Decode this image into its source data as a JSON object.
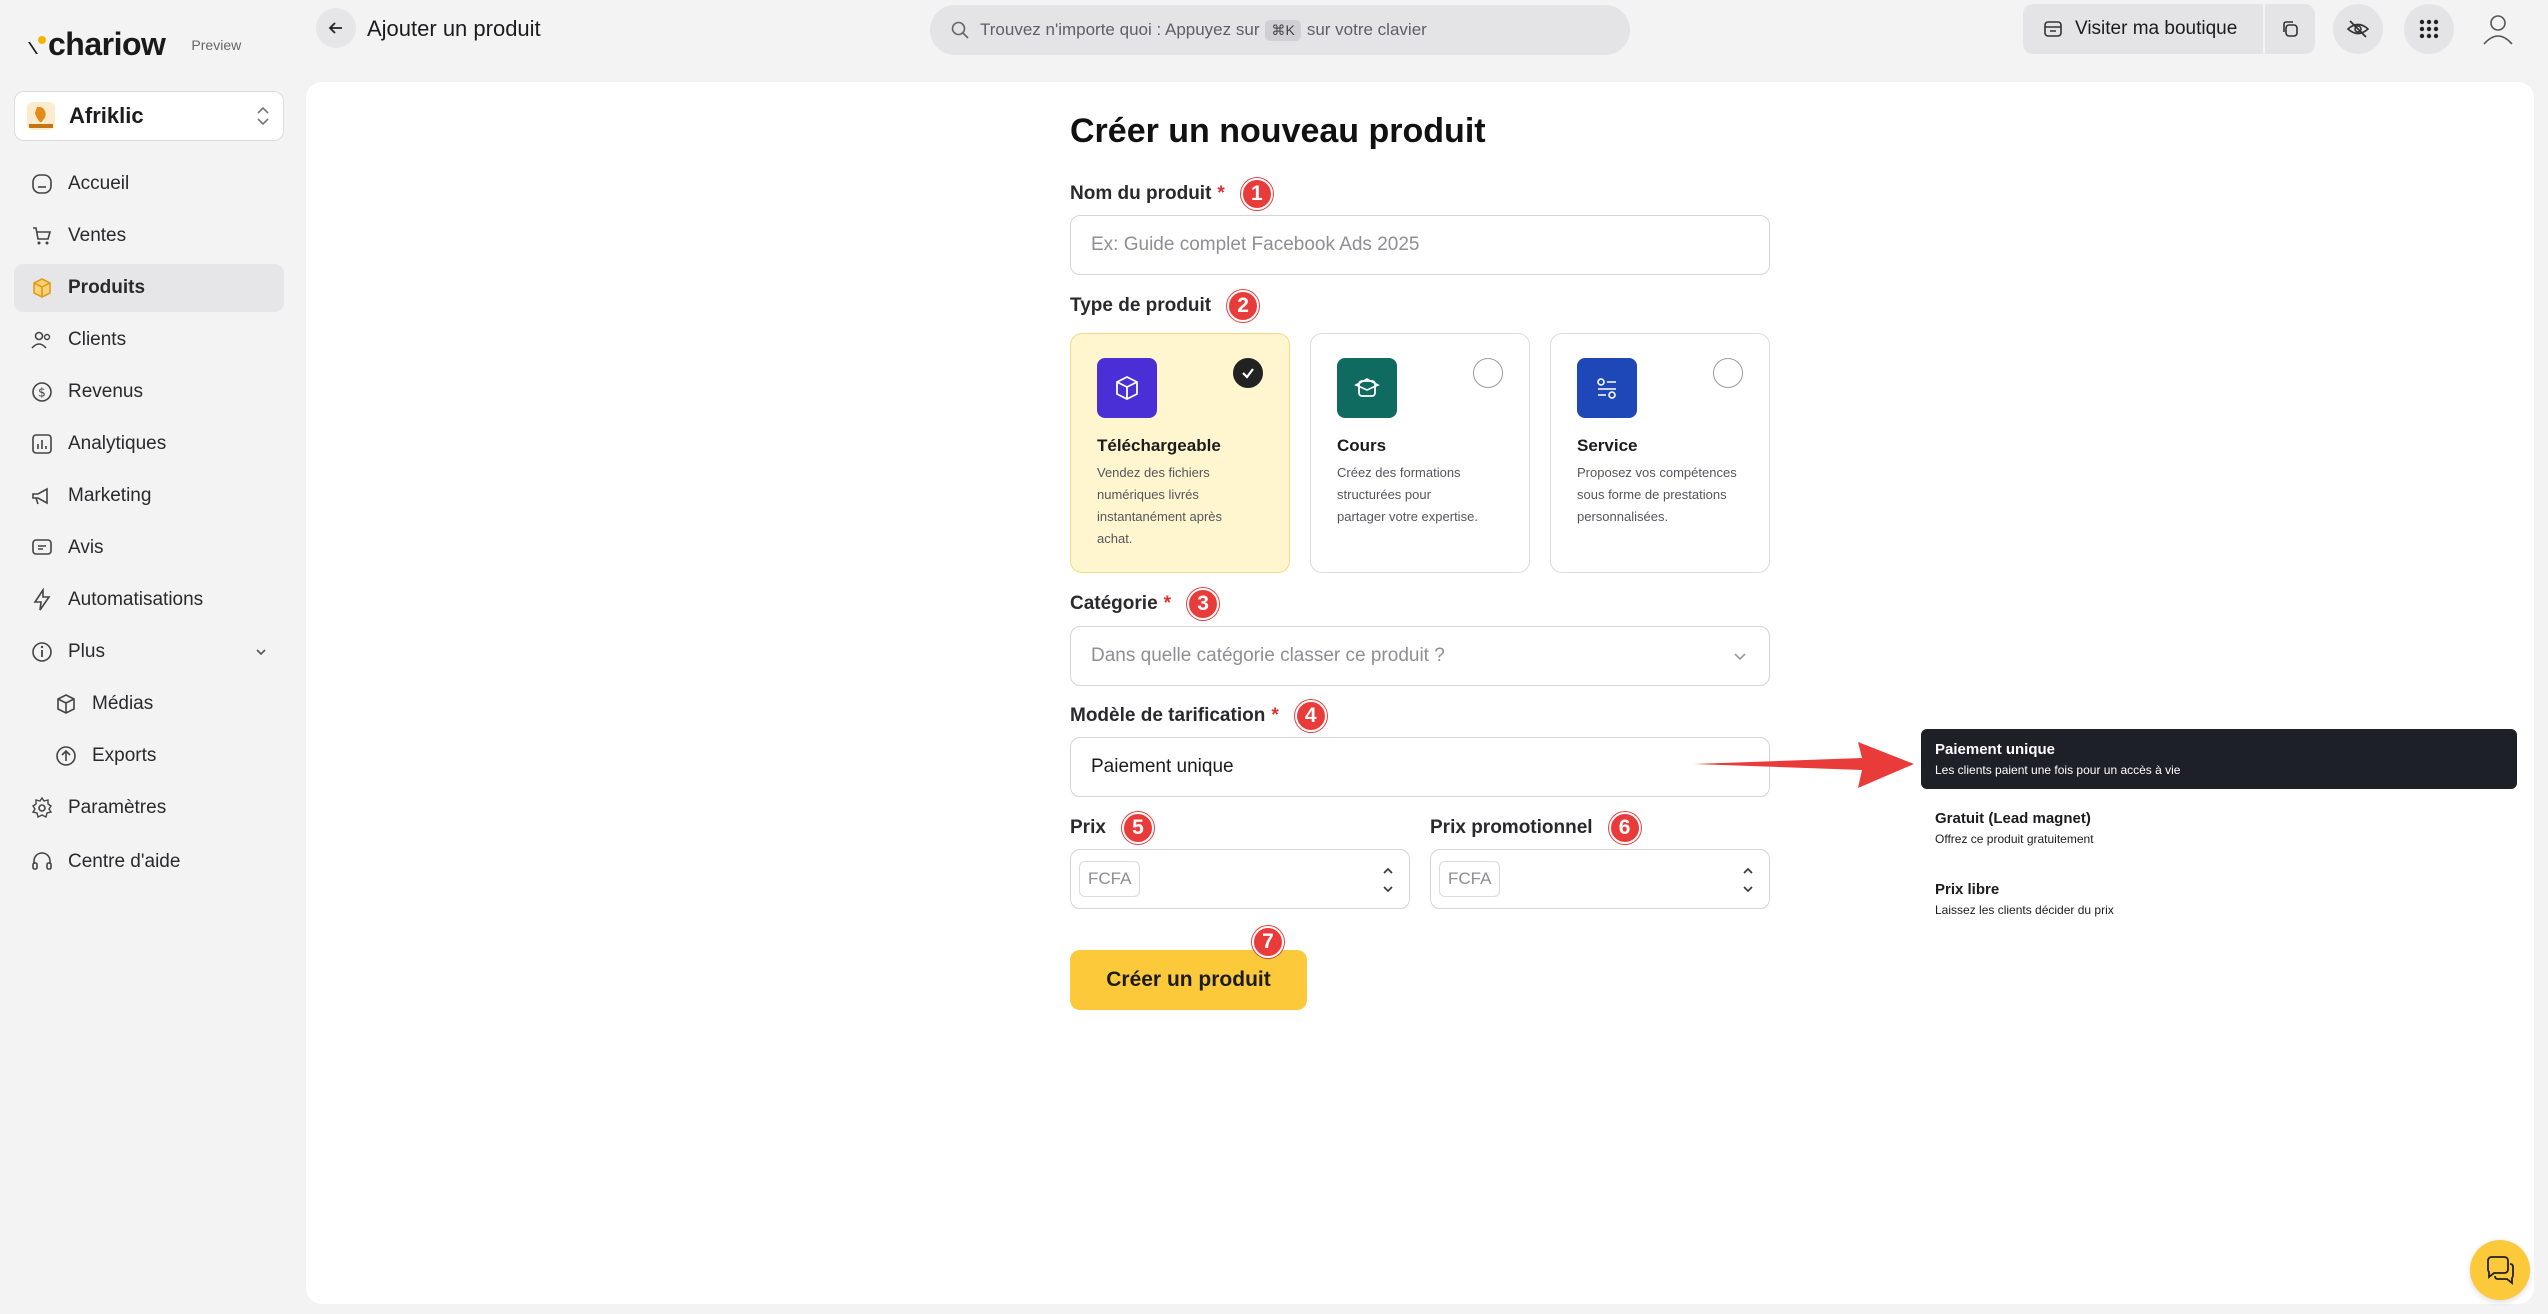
{
  "app": {
    "brand": "chariow",
    "badge": "Preview"
  },
  "shop": {
    "name": "Afriklic",
    "avatar_text": "AFRIKLIC"
  },
  "sidebar": {
    "items": [
      {
        "label": "Accueil",
        "icon": "home-icon"
      },
      {
        "label": "Ventes",
        "icon": "cart-icon"
      },
      {
        "label": "Produits",
        "icon": "box-icon",
        "active": true
      },
      {
        "label": "Clients",
        "icon": "users-icon"
      },
      {
        "label": "Revenus",
        "icon": "dollar-icon"
      },
      {
        "label": "Analytiques",
        "icon": "bar-chart-icon"
      },
      {
        "label": "Marketing",
        "icon": "megaphone-icon"
      },
      {
        "label": "Avis",
        "icon": "message-icon"
      },
      {
        "label": "Automatisations",
        "icon": "bolt-icon"
      },
      {
        "label": "Plus",
        "icon": "info-icon"
      },
      {
        "label": "Médias",
        "icon": "box-icon"
      },
      {
        "label": "Exports",
        "icon": "upload-icon"
      },
      {
        "label": "Paramètres",
        "icon": "gear-icon"
      }
    ],
    "help": "Centre d'aide"
  },
  "header": {
    "title": "Ajouter un produit",
    "search_prefix": "Trouvez n'importe quoi : Appuyez sur",
    "search_kbd": "⌘K",
    "search_suffix": "sur votre clavier",
    "visit_label": "Visiter ma boutique"
  },
  "form": {
    "heading": "Créer un nouveau produit",
    "name_label": "Nom du produit",
    "name_placeholder": "Ex: Guide complet Facebook Ads 2025",
    "type_label": "Type de produit",
    "types": [
      {
        "title": "Téléchargeable",
        "desc": "Vendez des fichiers numériques livrés instantanément après achat.",
        "selected": true
      },
      {
        "title": "Cours",
        "desc": "Créez des formations structurées pour partager votre expertise.",
        "selected": false
      },
      {
        "title": "Service",
        "desc": "Proposez vos compétences sous forme de prestations personnalisées.",
        "selected": false
      }
    ],
    "category_label": "Catégorie",
    "category_placeholder": "Dans quelle catégorie classer ce produit ?",
    "pricing_label": "Modèle de tarification",
    "pricing_value": "Paiement unique",
    "price_label": "Prix",
    "promo_label": "Prix promotionnel",
    "currency": "FCFA",
    "submit_label": "Créer un produit",
    "required_mark": "*"
  },
  "steps": [
    "1",
    "2",
    "3",
    "4",
    "5",
    "6",
    "7"
  ],
  "pricing_options": [
    {
      "title": "Paiement unique",
      "desc": "Les clients paient une fois pour un accès à vie",
      "active": true
    },
    {
      "title": "Gratuit (Lead magnet)",
      "desc": "Offrez ce produit gratuitement",
      "active": false
    },
    {
      "title": "Prix libre",
      "desc": "Laissez les clients décider du prix",
      "active": false
    }
  ],
  "colors": {
    "accent": "#fbc93a",
    "step_badge": "#ea3b3b",
    "download_icon": "#4b2fd6",
    "course_icon": "#0f6b5f",
    "service_icon": "#1e48b8"
  }
}
